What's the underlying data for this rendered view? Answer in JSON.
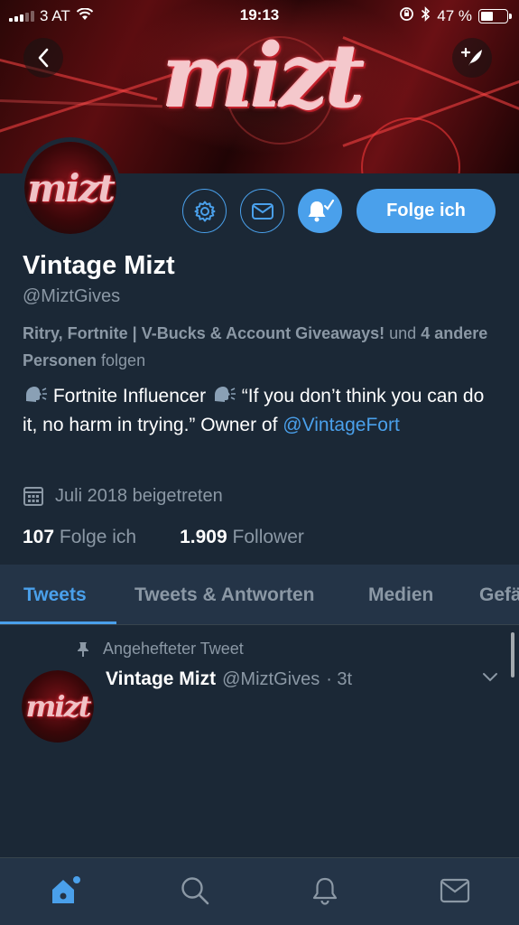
{
  "status_bar": {
    "carrier": "3 AT",
    "time": "19:13",
    "battery_percent": "47 %",
    "battery_level": 0.47
  },
  "banner": {
    "logo_text": "mizt"
  },
  "avatar": {
    "logo_text": "mizt"
  },
  "profile": {
    "follow_button_label": "Folge ich",
    "name": "Vintage Mizt",
    "handle": "@MiztGives",
    "followed_by": {
      "names": "Ritry, Fortnite | V-Bucks & Account Giveaways!",
      "und": " und ",
      "others": "4 andere Personen",
      "suffix": " folgen"
    },
    "bio": {
      "part1": " Fortnite Influencer ",
      "part2": " “If you don’t think you can do it, no harm in trying.” Owner of ",
      "link": "@VintageFort"
    },
    "joined": "Juli 2018 beigetreten",
    "following_count": "107",
    "following_label": "Folge ich",
    "followers_count": "1.909",
    "followers_label": "Follower"
  },
  "tabs": [
    {
      "label": "Tweets",
      "active": true
    },
    {
      "label": "Tweets & Antworten",
      "active": false
    },
    {
      "label": "Medien",
      "active": false
    },
    {
      "label": "Gefä",
      "active": false
    }
  ],
  "pinned_tweet": {
    "pinned_label": "Angehefteter Tweet",
    "author_name": "Vintage Mizt",
    "author_handle": "@MiztGives",
    "time": "· 3t"
  },
  "colors": {
    "accent": "#4aa0eb",
    "background": "#1b2836",
    "surface": "#243447",
    "muted_text": "#8b98a5"
  },
  "bottom_nav": [
    {
      "icon": "home-icon",
      "active": true
    },
    {
      "icon": "search-icon",
      "active": false
    },
    {
      "icon": "bell-icon",
      "active": false
    },
    {
      "icon": "mail-icon",
      "active": false
    }
  ]
}
